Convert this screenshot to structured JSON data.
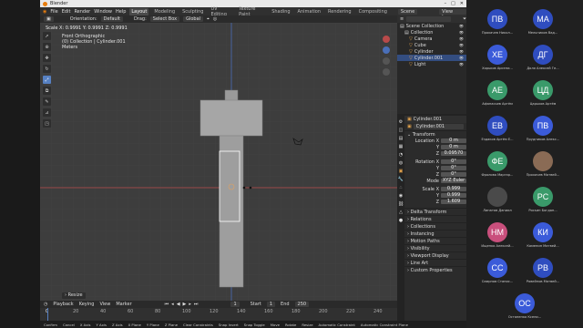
{
  "titlebar": {
    "title": "Blender"
  },
  "menubar": {
    "menus": [
      "File",
      "Edit",
      "Render",
      "Window",
      "Help"
    ],
    "tabs": [
      "Layout",
      "Modeling",
      "Sculpting",
      "UV Editing",
      "Texture Paint",
      "Shading",
      "Animation",
      "Rendering",
      "Compositing"
    ],
    "scene": "Scene",
    "view_layer": "View Layer"
  },
  "header": {
    "orientation_label": "Orientation:",
    "orientation_value": "Default",
    "drag_label": "Drag:",
    "drag_value": "Select Box",
    "transform_space": "Global"
  },
  "viewport": {
    "scale_readout": "Scale X: 0.9991   Y: 0.9991   Z: 0.9991",
    "view_name": "Front Orthographic",
    "collection_line": "(0) Collection | Cylinder.001",
    "units": "Meters"
  },
  "outliner": {
    "rows": [
      {
        "label": "Scene Collection",
        "selected": false,
        "indent": 0
      },
      {
        "label": "Collection",
        "selected": false,
        "indent": 1
      },
      {
        "label": "Camera",
        "selected": false,
        "indent": 2
      },
      {
        "label": "Cube",
        "selected": false,
        "indent": 2
      },
      {
        "label": "Cylinder",
        "selected": false,
        "indent": 2
      },
      {
        "label": "Cylinder.001",
        "selected": true,
        "indent": 2
      },
      {
        "label": "Light",
        "selected": false,
        "indent": 2
      }
    ]
  },
  "properties": {
    "object_name": "Cylinder.001",
    "datablock_name": "Cylinder.001",
    "transform_title": "Transform",
    "location": {
      "label": "Location X",
      "x": "0 m",
      "y": "0 m",
      "z": "0.09570"
    },
    "rotation": {
      "label": "Rotation X",
      "x": "0°",
      "y": "0°",
      "z": "0°"
    },
    "mode": {
      "label": "Mode",
      "value": "XYZ Euler"
    },
    "scale": {
      "label": "Scale X",
      "x": "0.999",
      "y": "0.999",
      "z": "1.609"
    },
    "sections": [
      "Delta Transform",
      "Relations",
      "Collections",
      "Instancing",
      "Motion Paths",
      "Visibility",
      "Viewport Display",
      "Line Art",
      "Custom Properties"
    ]
  },
  "timeline": {
    "menus": [
      "Playback",
      "Keying",
      "View",
      "Marker"
    ],
    "start_label": "Start",
    "start_value": "1",
    "end_label": "End",
    "end_value": "250",
    "current_frame": "1",
    "ticks": [
      "0",
      "20",
      "40",
      "60",
      "80",
      "100",
      "120",
      "140",
      "160",
      "180",
      "200",
      "220",
      "240"
    ]
  },
  "operator_panel": {
    "label": "Resize"
  },
  "statusbar": {
    "items": [
      "Confirm",
      "Cancel",
      "X Axis",
      "Y Axis",
      "Z Axis",
      "X Plane",
      "Y Plane",
      "Z Plane",
      "Clear Constraints",
      "Snap Invert",
      "Snap Toggle",
      "Move",
      "Rotate",
      "Resize",
      "Automatic Constraint",
      "Automatic Constraint Plane"
    ]
  },
  "participants": [
    {
      "initials": "ПВ",
      "name": "Прохачев Никол...",
      "color": "#2f4dbf"
    },
    {
      "initials": "МА",
      "name": "Мельников Вад...",
      "color": "#2f4dbf"
    },
    {
      "initials": "ХЕ",
      "name": "Хорьков Арсени...",
      "color": "#3b5bd9"
    },
    {
      "initials": "ДГ",
      "name": "Доля Алексей Ге...",
      "color": "#2f4dbf"
    },
    {
      "initials": "АЕ",
      "name": "Афанасьев Артём",
      "color": "#3a9a6a"
    },
    {
      "initials": "ЦД",
      "name": "Царьков Артём",
      "color": "#3a9a6a"
    },
    {
      "initials": "ЕВ",
      "name": "Ездаков Артём Е...",
      "color": "#2f4dbf"
    },
    {
      "initials": "ПВ",
      "name": "Прудников Алекс...",
      "color": "#3b5bd9"
    },
    {
      "initials": "ФЕ",
      "name": "Фролова Маргар...",
      "color": "#3a9a6a"
    },
    {
      "initials": "",
      "name": "Прохачев Матвей...",
      "color": "#8a6b55"
    },
    {
      "initials": "",
      "name": "Липатов Даниил",
      "color": "#4a4a4a"
    },
    {
      "initials": "РС",
      "name": "Роскин Богдан...",
      "color": "#3a9a6a"
    },
    {
      "initials": "НМ",
      "name": "Ищенко Алексей...",
      "color": "#c94f7c"
    },
    {
      "initials": "КИ",
      "name": "Каменин Матвей...",
      "color": "#3b5bd9"
    },
    {
      "initials": "СС",
      "name": "Смирнов Станис...",
      "color": "#3b5bd9"
    },
    {
      "initials": "РВ",
      "name": "Ровейнов Матвей...",
      "color": "#2f4dbf"
    },
    {
      "initials": "ОС",
      "name": "Остапенко Ксени...",
      "color": "#3b5bd9"
    }
  ],
  "colors": {
    "accent_blue": "#5680c2",
    "blender_orange": "#e87d0d",
    "selected_outline": "#ffffff",
    "x_axis_red": "#b84a4a",
    "z_axis_blue": "#4a6fb8"
  }
}
